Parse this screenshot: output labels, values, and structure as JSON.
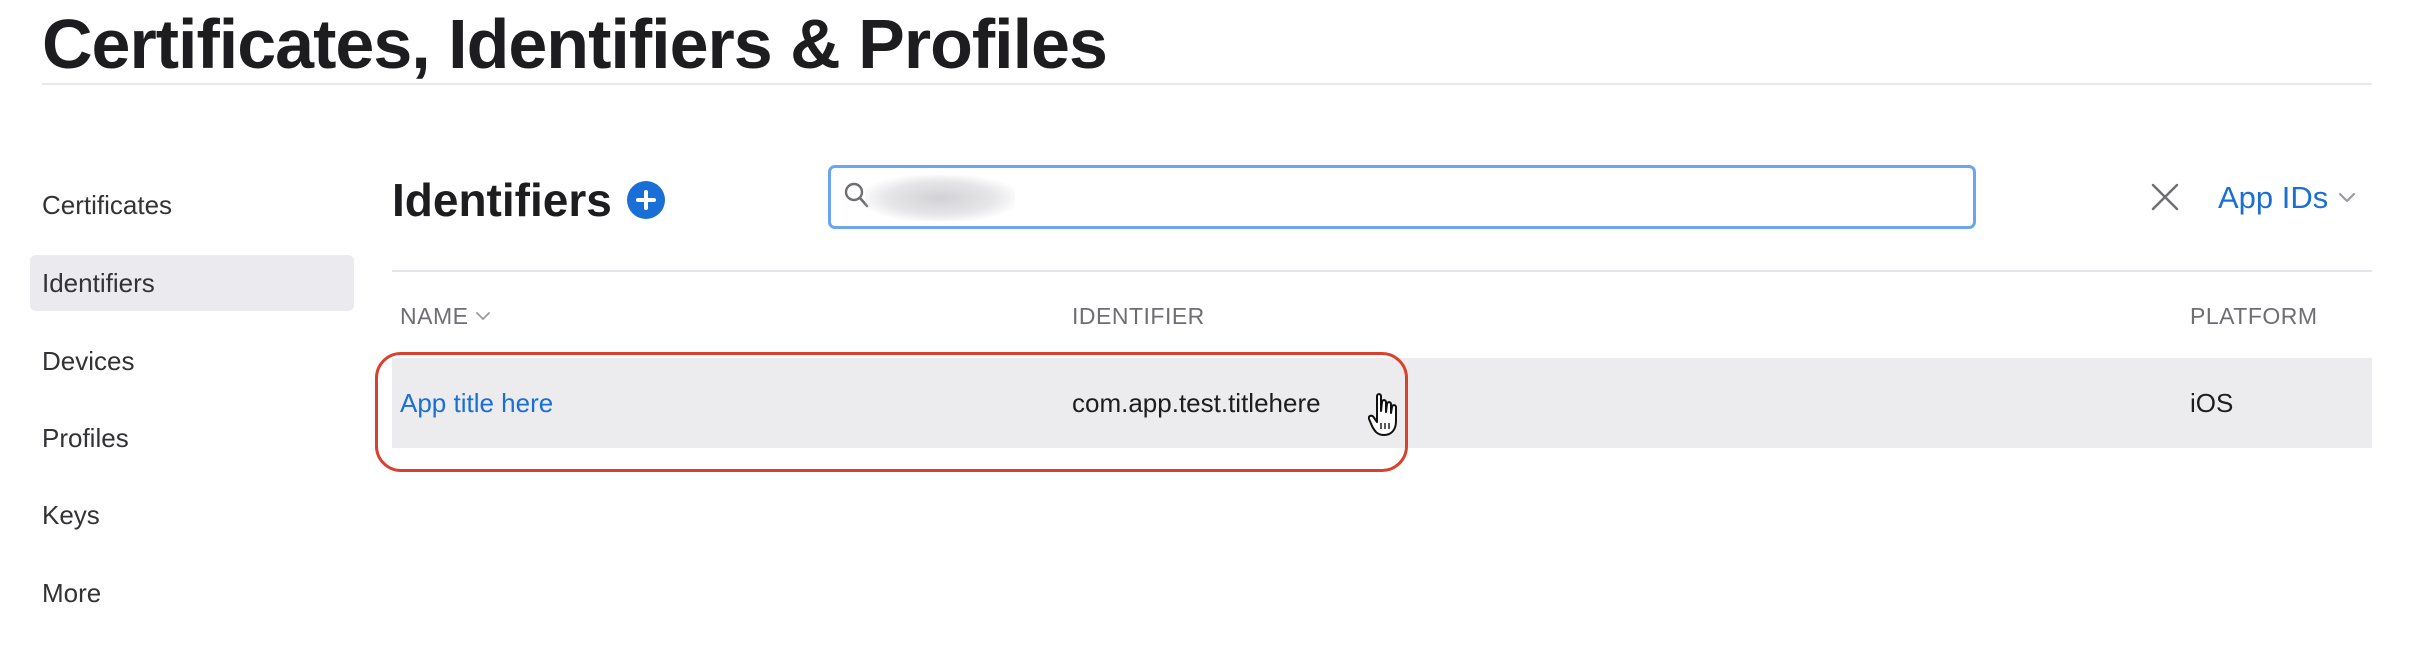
{
  "header": {
    "title": "Certificates, Identifiers & Profiles"
  },
  "sidebar": {
    "items": [
      {
        "label": "Certificates",
        "active": false
      },
      {
        "label": "Identifiers",
        "active": true
      },
      {
        "label": "Devices",
        "active": false
      },
      {
        "label": "Profiles",
        "active": false
      },
      {
        "label": "Keys",
        "active": false
      },
      {
        "label": "More",
        "active": false
      }
    ]
  },
  "main": {
    "section_title": "Identifiers",
    "add_icon": "plus-circle-icon",
    "search": {
      "value": "",
      "placeholder": "",
      "icon": "search-icon",
      "clear_icon": "close-icon"
    },
    "filter": {
      "label": "App IDs",
      "icon": "chevron-down-icon"
    },
    "table": {
      "columns": [
        {
          "label": "NAME",
          "sortable": true
        },
        {
          "label": "IDENTIFIER",
          "sortable": false
        },
        {
          "label": "PLATFORM",
          "sortable": false
        }
      ],
      "rows": [
        {
          "name": "App title here",
          "identifier": "com.app.test.titlehere",
          "platform": "iOS"
        }
      ]
    }
  },
  "colors": {
    "accent": "#1a6fd6",
    "highlight_ring": "#d9412d",
    "row_background": "#ececef",
    "sidebar_active": "#ebebef"
  }
}
